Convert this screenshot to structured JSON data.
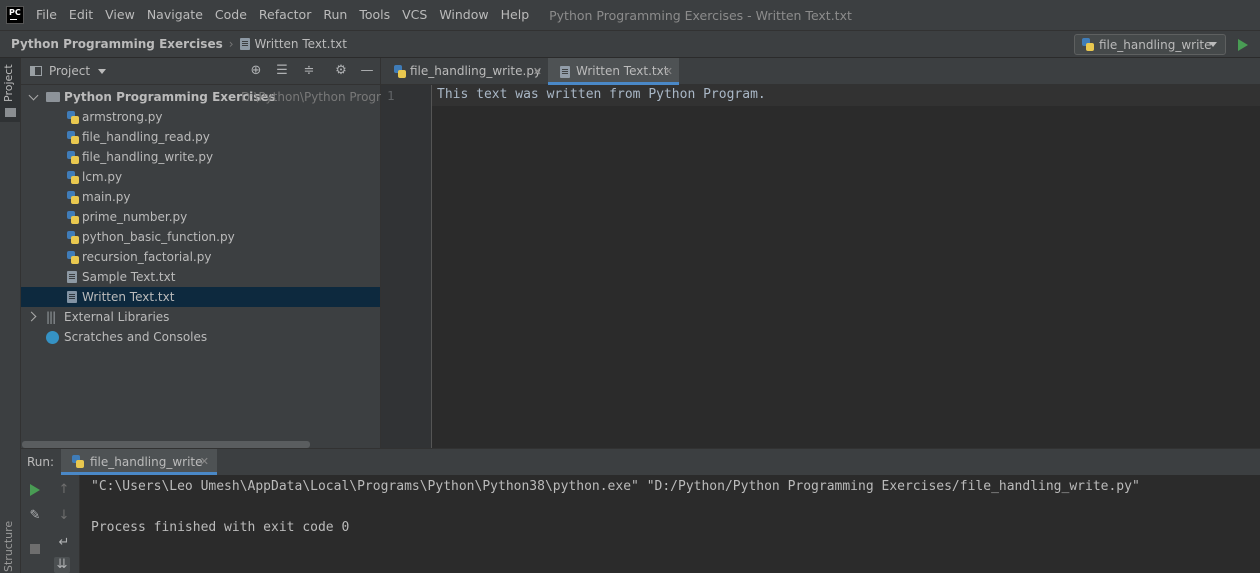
{
  "menubar": {
    "logo": "PC",
    "items": [
      "File",
      "Edit",
      "View",
      "Navigate",
      "Code",
      "Refactor",
      "Run",
      "Tools",
      "VCS",
      "Window",
      "Help"
    ],
    "window_title": "Python Programming Exercises - Written Text.txt"
  },
  "navbar": {
    "project": "Python Programming Exercises",
    "file": "Written Text.txt",
    "run_config": "file_handling_write"
  },
  "left_stripe": {
    "project_label": "Project",
    "structure_label": "Structure"
  },
  "project_panel": {
    "title": "Project",
    "root_name": "Python Programming Exercises",
    "root_path": "D:\\Python\\Python Program",
    "files": [
      {
        "name": "armstrong.py",
        "type": "python"
      },
      {
        "name": "file_handling_read.py",
        "type": "python"
      },
      {
        "name": "file_handling_write.py",
        "type": "python"
      },
      {
        "name": "lcm.py",
        "type": "python"
      },
      {
        "name": "main.py",
        "type": "python"
      },
      {
        "name": "prime_number.py",
        "type": "python"
      },
      {
        "name": "python_basic_function.py",
        "type": "python"
      },
      {
        "name": "recursion_factorial.py",
        "type": "python"
      },
      {
        "name": "Sample Text.txt",
        "type": "text"
      },
      {
        "name": "Written Text.txt",
        "type": "text",
        "selected": true
      }
    ],
    "external_libraries": "External Libraries",
    "scratches": "Scratches and Consoles"
  },
  "editor": {
    "tabs": [
      {
        "label": "file_handling_write.py",
        "active": false
      },
      {
        "label": "Written Text.txt",
        "active": true
      }
    ],
    "line_number": "1",
    "content": "This text was written from Python Program."
  },
  "run_panel": {
    "label": "Run:",
    "tab": "file_handling_write",
    "output": [
      "\"C:\\Users\\Leo Umesh\\AppData\\Local\\Programs\\Python\\Python38\\python.exe\" \"D:/Python/Python Programming Exercises/file_handling_write.py\"",
      "",
      "Process finished with exit code 0"
    ]
  },
  "colors": {
    "selection": "#0d293e",
    "active_tab_underline": "#4a88c7",
    "run_green": "#499c54"
  }
}
